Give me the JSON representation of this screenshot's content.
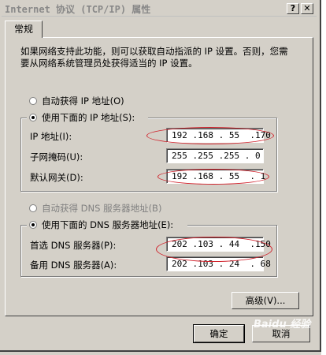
{
  "window": {
    "title": "Internet 协议 (TCP/IP) 属性",
    "help_glyph": "?",
    "close_glyph": "✕"
  },
  "tabs": [
    {
      "label": "常规"
    }
  ],
  "description": "如果网络支持此功能，则可以获取自动指派的 IP 设置。否则，您需要从网络系统管理员处获得适当的 IP 设置。",
  "ip_section": {
    "auto_label": "自动获得 IP 地址(O)",
    "manual_label": "使用下面的 IP 地址(S):",
    "selected": "manual",
    "fields": [
      {
        "label": "IP 地址(I):",
        "value": "192 .168 . 55  .170"
      },
      {
        "label": "子网掩码(U):",
        "value": "255 .255 .255 . 0"
      },
      {
        "label": "默认网关(D):",
        "value": "192 .168 . 55  . 1"
      }
    ]
  },
  "dns_section": {
    "auto_label": "自动获得 DNS 服务器地址(B)",
    "manual_label": "使用下面的 DNS 服务器地址(E):",
    "selected": "manual",
    "fields": [
      {
        "label": "首选 DNS 服务器(P):",
        "value": "202 .103 . 44  .150"
      },
      {
        "label": "备用 DNS 服务器(A):",
        "value": "202 .103 . 24  . 68"
      }
    ]
  },
  "buttons": {
    "advanced": "高级(V)...",
    "ok": "确定",
    "cancel": "取消"
  },
  "watermark": "Baidu 经验",
  "colors": {
    "face": "#d4d0c8",
    "annotation": "#d0202a"
  }
}
